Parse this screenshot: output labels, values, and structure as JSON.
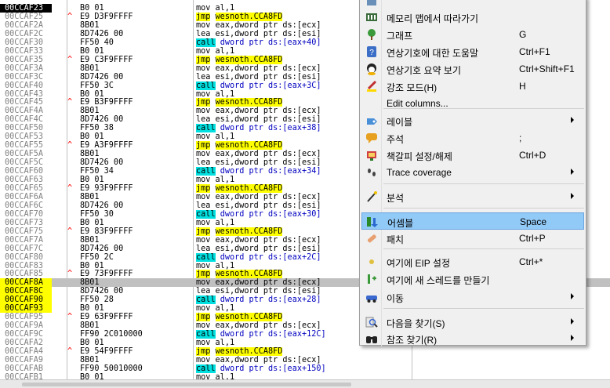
{
  "rows": [
    {
      "addr": "00CCAF23",
      "mark": "",
      "bytes": "B0 01",
      "mn": "mov",
      "ops": "al,1",
      "type": "mov_al",
      "eip": true
    },
    {
      "addr": "00CCAF25",
      "mark": "^",
      "bytes": "E9 D3F9FFFF",
      "mn": "jmp",
      "ops": "wesnoth.CCA8FD",
      "type": "jmp"
    },
    {
      "addr": "00CCAF2A",
      "mark": "",
      "bytes": "8B01",
      "mn": "mov",
      "ops": "eax,dword ptr ds:[ecx]",
      "type": "mov_eax"
    },
    {
      "addr": "00CCAF2C",
      "mark": "",
      "bytes": "8D7426 00",
      "mn": "lea",
      "ops": "esi,dword ptr ds:[esi]",
      "type": "lea"
    },
    {
      "addr": "00CCAF30",
      "mark": "",
      "bytes": "FF50 40",
      "mn": "call",
      "ops": "dword ptr ds:[eax+40]",
      "type": "call"
    },
    {
      "addr": "00CCAF33",
      "mark": "",
      "bytes": "B0 01",
      "mn": "mov",
      "ops": "al,1",
      "type": "mov_al"
    },
    {
      "addr": "00CCAF35",
      "mark": "^",
      "bytes": "E9 C3F9FFFF",
      "mn": "jmp",
      "ops": "wesnoth.CCA8FD",
      "type": "jmp"
    },
    {
      "addr": "00CCAF3A",
      "mark": "",
      "bytes": "8B01",
      "mn": "mov",
      "ops": "eax,dword ptr ds:[ecx]",
      "type": "mov_eax"
    },
    {
      "addr": "00CCAF3C",
      "mark": "",
      "bytes": "8D7426 00",
      "mn": "lea",
      "ops": "esi,dword ptr ds:[esi]",
      "type": "lea"
    },
    {
      "addr": "00CCAF40",
      "mark": "",
      "bytes": "FF50 3C",
      "mn": "call",
      "ops": "dword ptr ds:[eax+3C]",
      "type": "call"
    },
    {
      "addr": "00CCAF43",
      "mark": "",
      "bytes": "B0 01",
      "mn": "mov",
      "ops": "al,1",
      "type": "mov_al"
    },
    {
      "addr": "00CCAF45",
      "mark": "^",
      "bytes": "E9 B3F9FFFF",
      "mn": "jmp",
      "ops": "wesnoth.CCA8FD",
      "type": "jmp"
    },
    {
      "addr": "00CCAF4A",
      "mark": "",
      "bytes": "8B01",
      "mn": "mov",
      "ops": "eax,dword ptr ds:[ecx]",
      "type": "mov_eax"
    },
    {
      "addr": "00CCAF4C",
      "mark": "",
      "bytes": "8D7426 00",
      "mn": "lea",
      "ops": "esi,dword ptr ds:[esi]",
      "type": "lea"
    },
    {
      "addr": "00CCAF50",
      "mark": "",
      "bytes": "FF50 38",
      "mn": "call",
      "ops": "dword ptr ds:[eax+38]",
      "type": "call"
    },
    {
      "addr": "00CCAF53",
      "mark": "",
      "bytes": "B0 01",
      "mn": "mov",
      "ops": "al,1",
      "type": "mov_al"
    },
    {
      "addr": "00CCAF55",
      "mark": "^",
      "bytes": "E9 A3F9FFFF",
      "mn": "jmp",
      "ops": "wesnoth.CCA8FD",
      "type": "jmp"
    },
    {
      "addr": "00CCAF5A",
      "mark": "",
      "bytes": "8B01",
      "mn": "mov",
      "ops": "eax,dword ptr ds:[ecx]",
      "type": "mov_eax"
    },
    {
      "addr": "00CCAF5C",
      "mark": "",
      "bytes": "8D7426 00",
      "mn": "lea",
      "ops": "esi,dword ptr ds:[esi]",
      "type": "lea"
    },
    {
      "addr": "00CCAF60",
      "mark": "",
      "bytes": "FF50 34",
      "mn": "call",
      "ops": "dword ptr ds:[eax+34]",
      "type": "call"
    },
    {
      "addr": "00CCAF63",
      "mark": "",
      "bytes": "B0 01",
      "mn": "mov",
      "ops": "al,1",
      "type": "mov_al"
    },
    {
      "addr": "00CCAF65",
      "mark": "^",
      "bytes": "E9 93F9FFFF",
      "mn": "jmp",
      "ops": "wesnoth.CCA8FD",
      "type": "jmp"
    },
    {
      "addr": "00CCAF6A",
      "mark": "",
      "bytes": "8B01",
      "mn": "mov",
      "ops": "eax,dword ptr ds:[ecx]",
      "type": "mov_eax"
    },
    {
      "addr": "00CCAF6C",
      "mark": "",
      "bytes": "8D7426 00",
      "mn": "lea",
      "ops": "esi,dword ptr ds:[esi]",
      "type": "lea"
    },
    {
      "addr": "00CCAF70",
      "mark": "",
      "bytes": "FF50 30",
      "mn": "call",
      "ops": "dword ptr ds:[eax+30]",
      "type": "call"
    },
    {
      "addr": "00CCAF73",
      "mark": "",
      "bytes": "B0 01",
      "mn": "mov",
      "ops": "al,1",
      "type": "mov_al"
    },
    {
      "addr": "00CCAF75",
      "mark": "^",
      "bytes": "E9 83F9FFFF",
      "mn": "jmp",
      "ops": "wesnoth.CCA8FD",
      "type": "jmp"
    },
    {
      "addr": "00CCAF7A",
      "mark": "",
      "bytes": "8B01",
      "mn": "mov",
      "ops": "eax,dword ptr ds:[ecx]",
      "type": "mov_eax"
    },
    {
      "addr": "00CCAF7C",
      "mark": "",
      "bytes": "8D7426 00",
      "mn": "lea",
      "ops": "esi,dword ptr ds:[esi]",
      "type": "lea"
    },
    {
      "addr": "00CCAF80",
      "mark": "",
      "bytes": "FF50 2C",
      "mn": "call",
      "ops": "dword ptr ds:[eax+2C]",
      "type": "call"
    },
    {
      "addr": "00CCAF83",
      "mark": "",
      "bytes": "B0 01",
      "mn": "mov",
      "ops": "al,1",
      "type": "mov_al"
    },
    {
      "addr": "00CCAF85",
      "mark": "^",
      "bytes": "E9 73F9FFFF",
      "mn": "jmp",
      "ops": "wesnoth.CCA8FD",
      "type": "jmp"
    },
    {
      "addr": "00CCAF8A",
      "mark": "",
      "bytes": "8B01",
      "mn": "mov",
      "ops": "eax,dword ptr ds:[ecx]",
      "type": "mov_eax",
      "yl": true,
      "sel": true
    },
    {
      "addr": "00CCAF8C",
      "mark": "",
      "bytes": "8D7426 00",
      "mn": "lea",
      "ops": "esi,dword ptr ds:[esi]",
      "type": "lea",
      "yl": true
    },
    {
      "addr": "00CCAF90",
      "mark": "",
      "bytes": "FF50 28",
      "mn": "call",
      "ops": "dword ptr ds:[eax+28]",
      "type": "call",
      "yl": true
    },
    {
      "addr": "00CCAF93",
      "mark": "",
      "bytes": "B0 01",
      "mn": "mov",
      "ops": "al,1",
      "type": "mov_al",
      "yl": true
    },
    {
      "addr": "00CCAF95",
      "mark": "^",
      "bytes": "E9 63F9FFFF",
      "mn": "jmp",
      "ops": "wesnoth.CCA8FD",
      "type": "jmp"
    },
    {
      "addr": "00CCAF9A",
      "mark": "",
      "bytes": "8B01",
      "mn": "mov",
      "ops": "eax,dword ptr ds:[ecx]",
      "type": "mov_eax"
    },
    {
      "addr": "00CCAF9C",
      "mark": "",
      "bytes": "FF90 2C010000",
      "mn": "call",
      "ops": "dword ptr ds:[eax+12C]",
      "type": "call"
    },
    {
      "addr": "00CCAFA2",
      "mark": "",
      "bytes": "B0 01",
      "mn": "mov",
      "ops": "al,1",
      "type": "mov_al"
    },
    {
      "addr": "00CCAFA4",
      "mark": "^",
      "bytes": "E9 54F9FFFF",
      "mn": "jmp",
      "ops": "wesnoth.CCA8FD",
      "type": "jmp"
    },
    {
      "addr": "00CCAFA9",
      "mark": "",
      "bytes": "8B01",
      "mn": "mov",
      "ops": "eax,dword ptr ds:[ecx]",
      "type": "mov_eax"
    },
    {
      "addr": "00CCAFAB",
      "mark": "",
      "bytes": "FF90 50010000",
      "mn": "call",
      "ops": "dword ptr ds:[eax+150]",
      "type": "call"
    },
    {
      "addr": "00CCAFB1",
      "mark": "",
      "bytes": "B0 01",
      "mn": "mov",
      "ops": "al,1",
      "type": "mov_al"
    }
  ],
  "menu": {
    "items": [
      {
        "icon": "memory-map-icon",
        "label": "메모리 맵에서 따라가기",
        "shortcut": "",
        "sub": false
      },
      {
        "icon": "graph-tree-icon",
        "label": "그래프",
        "shortcut": "G",
        "sub": false
      },
      {
        "icon": "help-icon",
        "label": "연상기호에 대한 도움말",
        "shortcut": "Ctrl+F1",
        "sub": false
      },
      {
        "icon": "mnemonic-brief-icon",
        "label": "연상기호 요약 보기",
        "shortcut": "Ctrl+Shift+F1",
        "sub": false
      },
      {
        "icon": "highlight-pen-icon",
        "label": "강조 모드(H)",
        "shortcut": "H",
        "sub": false
      },
      {
        "icon": "none",
        "label": "Edit columns...",
        "shortcut": "",
        "sub": false
      },
      {
        "icon": "label-icon",
        "label": "레이블",
        "shortcut": "",
        "sub": true
      },
      {
        "icon": "comment-icon",
        "label": "주석",
        "shortcut": ";",
        "sub": false
      },
      {
        "icon": "bookmark-icon",
        "label": "책갈피 설정/해제",
        "shortcut": "Ctrl+D",
        "sub": false
      },
      {
        "icon": "trace-footprints-icon",
        "label": "Trace coverage",
        "shortcut": "",
        "sub": true
      },
      {
        "icon": "analysis-wand-icon",
        "label": "분석",
        "shortcut": "",
        "sub": true
      },
      {
        "icon": "assemble-icon",
        "label": "어셈블",
        "shortcut": "Space",
        "sub": false
      },
      {
        "icon": "patch-bandage-icon",
        "label": "패치",
        "shortcut": "Ctrl+P",
        "sub": false
      },
      {
        "icon": "set-eip-icon",
        "label": "여기에 EIP 설정",
        "shortcut": "Ctrl+*",
        "sub": false
      },
      {
        "icon": "new-thread-icon",
        "label": "여기에 새 스레드를 만들기",
        "shortcut": "",
        "sub": false
      },
      {
        "icon": "goto-car-icon",
        "label": "이동",
        "shortcut": "",
        "sub": true
      },
      {
        "icon": "find-magnifier-icon",
        "label": "다음을 찾기(S)",
        "shortcut": "",
        "sub": true
      },
      {
        "icon": "binoculars-icon",
        "label": "참조 찾기(R)",
        "shortcut": "",
        "sub": true
      }
    ]
  },
  "colors": {
    "eip_bg": "#000000",
    "jmp_hl": "#ffff00",
    "call_hl": "#00e0e0",
    "menu_active": "#91c9f7",
    "jmark": "#ff0000"
  }
}
